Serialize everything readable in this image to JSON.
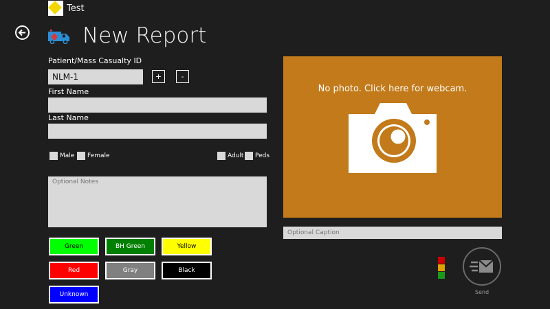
{
  "app": {
    "title": "Test"
  },
  "header": {
    "title": "New Report"
  },
  "form": {
    "patient_id_label": "Patient/Mass Casualty ID",
    "patient_id_value": "NLM-1",
    "increment_label": "+",
    "decrement_label": "-",
    "first_name_label": "First Name",
    "first_name_value": "",
    "last_name_label": "Last Name",
    "last_name_value": "",
    "gender": [
      "Male",
      "Female"
    ],
    "age_group": [
      "Adult",
      "Peds"
    ],
    "notes_placeholder": "Optional Notes"
  },
  "triage_buttons": [
    {
      "label": "Green",
      "bg": "#00ff00",
      "fg": "#000000"
    },
    {
      "label": "BH Green",
      "bg": "#008000",
      "fg": "#ffffff"
    },
    {
      "label": "Yellow",
      "bg": "#ffff00",
      "fg": "#000000"
    },
    {
      "label": "Red",
      "bg": "#ff0000",
      "fg": "#ffffff"
    },
    {
      "label": "Gray",
      "bg": "#808080",
      "fg": "#ffffff"
    },
    {
      "label": "Black",
      "bg": "#000000",
      "fg": "#ffffff"
    },
    {
      "label": "Unknown",
      "bg": "#0000ff",
      "fg": "#ffffff"
    }
  ],
  "photo": {
    "prompt": "No photo.  Click here for webcam.",
    "bg": "#c27a1a",
    "icon": "camera-icon"
  },
  "caption": {
    "placeholder": "Optional Caption"
  },
  "traffic_light": [
    "#cc0000",
    "#e0a000",
    "#1a9a1a"
  ],
  "send": {
    "label": "Send",
    "icon": "send-mail-icon"
  }
}
